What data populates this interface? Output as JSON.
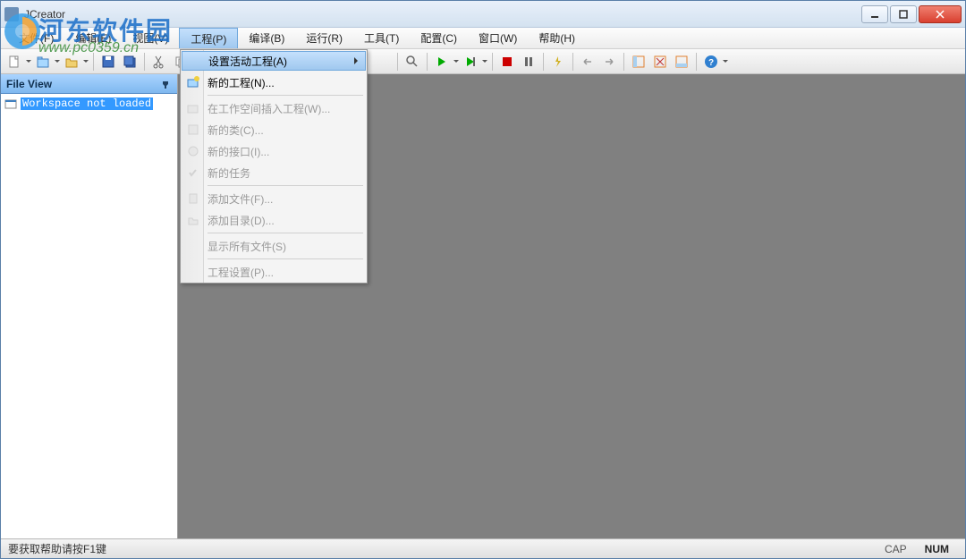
{
  "window": {
    "title": "JCreator"
  },
  "watermark": {
    "line1": "河东软件园",
    "line2": "www.pc0359.cn"
  },
  "menubar": {
    "items": [
      {
        "label": "文件(F)"
      },
      {
        "label": "编辑(E)"
      },
      {
        "label": "视图(V)"
      },
      {
        "label": "工程(P)",
        "open": true
      },
      {
        "label": "编译(B)"
      },
      {
        "label": "运行(R)"
      },
      {
        "label": "工具(T)"
      },
      {
        "label": "配置(C)"
      },
      {
        "label": "窗口(W)"
      },
      {
        "label": "帮助(H)"
      }
    ]
  },
  "dropdown": {
    "items": [
      {
        "label": "设置活动工程(A)",
        "submenu": true,
        "highlight": true
      },
      {
        "label": "新的工程(N)...",
        "icon": "new-project"
      },
      {
        "sep": true
      },
      {
        "label": "在工作空间插入工程(W)...",
        "disabled": true,
        "icon": "insert-project"
      },
      {
        "label": "新的类(C)...",
        "disabled": true,
        "icon": "new-class"
      },
      {
        "label": "新的接口(I)...",
        "disabled": true,
        "icon": "new-interface"
      },
      {
        "label": "新的任务",
        "disabled": true,
        "icon": "new-task"
      },
      {
        "sep": true
      },
      {
        "label": "添加文件(F)...",
        "disabled": true,
        "icon": "add-file"
      },
      {
        "label": "添加目录(D)...",
        "disabled": true,
        "icon": "add-folder"
      },
      {
        "sep": true
      },
      {
        "label": "显示所有文件(S)",
        "disabled": true
      },
      {
        "sep": true
      },
      {
        "label": "工程设置(P)...",
        "disabled": true
      }
    ]
  },
  "sidebar": {
    "title": "File View",
    "tree_item": "Workspace not loaded"
  },
  "statusbar": {
    "hint": "要获取帮助请按F1键",
    "cap": "CAP",
    "num": "NUM"
  }
}
